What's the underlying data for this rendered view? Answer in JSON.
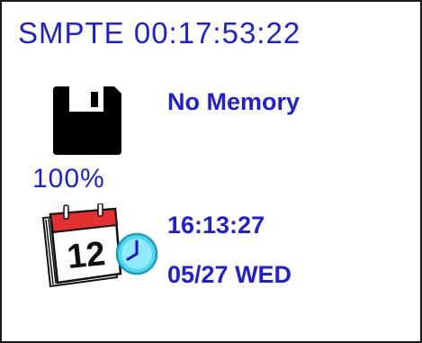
{
  "header": {
    "timecode": "SMPTE 00:17:53:22"
  },
  "storage": {
    "icon": "floppy-disk-icon",
    "status": "No Memory",
    "percent": "100%"
  },
  "datetime": {
    "icon": "calendar-clock-icon",
    "calendar_day": "12",
    "time": "16:13:27",
    "date": "05/27 WED"
  },
  "colors": {
    "text": "#1f1fd6",
    "calendar_red": "#e53030",
    "clock_cyan": "#4fd8f0"
  }
}
